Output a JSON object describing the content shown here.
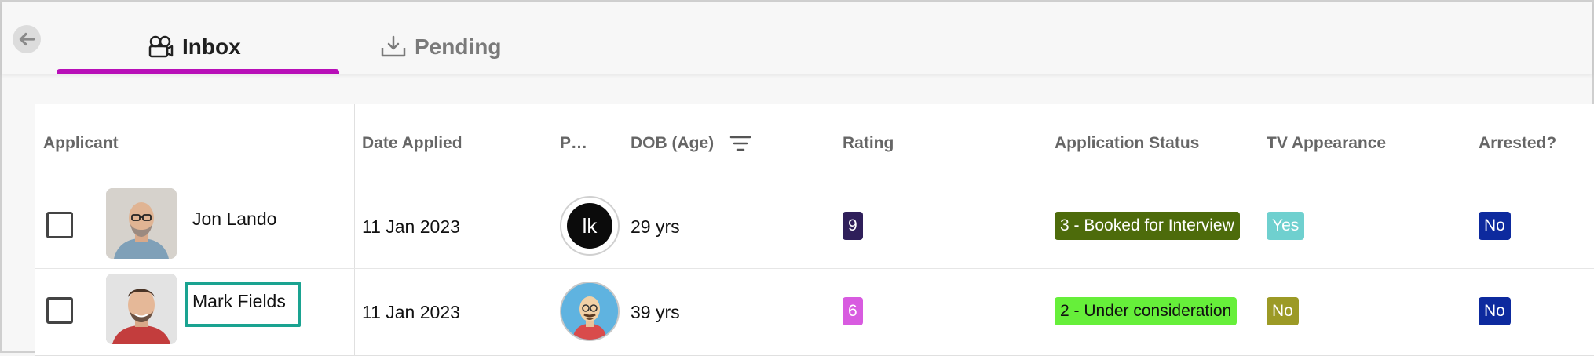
{
  "tabs": {
    "inbox_label": "Inbox",
    "pending_label": "Pending",
    "active": "Inbox",
    "active_color": "#b80fb8"
  },
  "table": {
    "headers": {
      "applicant": "Applicant",
      "date_applied": "Date Applied",
      "p": "P…",
      "dob": "DOB (Age)",
      "rating": "Rating",
      "status": "Application Status",
      "tv": "TV Appearance",
      "arrested": "Arrested?"
    },
    "rows": [
      {
        "name": "Jon Lando",
        "date_applied": "11 Jan 2023",
        "avatar_initials": "lk",
        "age": "29 yrs",
        "rating": "9",
        "rating_color": "#2f1f5a",
        "status": "3 - Booked for Interview",
        "status_color": "#4d6b0b",
        "tv": "Yes",
        "tv_color": "#6fd0cf",
        "arrested": "No",
        "arrested_color": "#0d2a9e"
      },
      {
        "name": "Mark Fields",
        "date_applied": "11 Jan 2023",
        "avatar_initials": "",
        "age": "39 yrs",
        "rating": "6",
        "rating_color": "#d85be0",
        "status": "2 - Under consideration",
        "status_color": "#66ef3a",
        "tv": "No",
        "tv_color": "#9c9a26",
        "arrested": "No",
        "arrested_color": "#0d2a9e"
      }
    ]
  },
  "icons": {
    "back": "arrow-left-icon",
    "inbox": "camera-reel-icon",
    "pending": "download-tray-icon",
    "filter": "filter-lines-icon"
  }
}
